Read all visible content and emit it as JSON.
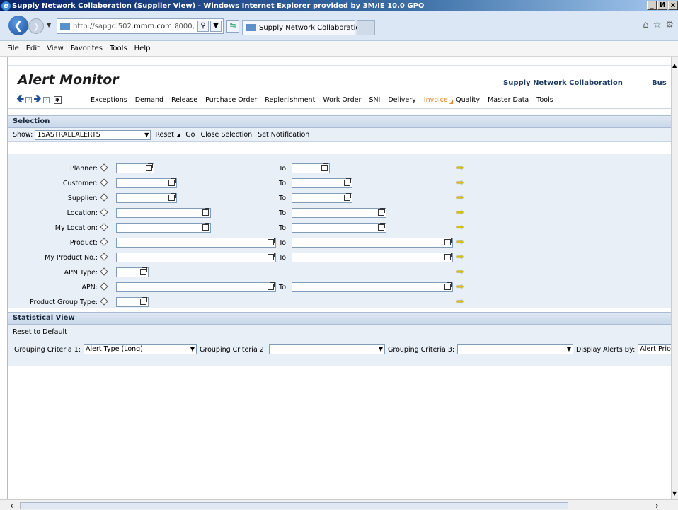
{
  "window": {
    "title": "Supply Network Collaboration (Supplier View) - Windows Internet Explorer provided by 3M/IE 10.0 GPO",
    "controls": [
      "_",
      "И",
      "x"
    ]
  },
  "browser": {
    "url_prefix": "http://sapgdl502.",
    "url_domain": "mmm.com",
    "url_suffix": ":8000,",
    "tab_label": "Supply Network Collaboratio...",
    "tab_close": "✖",
    "menu": [
      "File",
      "Edit",
      "View",
      "Favorites",
      "Tools",
      "Help"
    ]
  },
  "app": {
    "title": "Alert Monitor",
    "brand": "Supply Network Collaboration",
    "brand2": "Bus",
    "nav_items": [
      "Exceptions",
      "Demand",
      "Release",
      "Purchase Order",
      "Replenishment",
      "Work Order",
      "SNI",
      "Delivery",
      "Invoice",
      "Quality",
      "Master Data",
      "Tools"
    ],
    "active_nav": "Invoice"
  },
  "selection": {
    "header": "Selection",
    "show_label": "Show:",
    "show_value": "15ASTRALLALERTS",
    "reset": "Reset",
    "go": "Go",
    "close_selection": "Close Selection",
    "set_notification": "Set Notification",
    "to_label": "To",
    "fields": [
      {
        "label": "Planner:"
      },
      {
        "label": "Customer:"
      },
      {
        "label": "Supplier:"
      },
      {
        "label": "Location:"
      },
      {
        "label": "My Location:"
      },
      {
        "label": "Product:"
      },
      {
        "label": "My Product No.:"
      },
      {
        "label": "APN Type:"
      },
      {
        "label": "APN:"
      },
      {
        "label": "Product Group Type:"
      }
    ]
  },
  "statistical": {
    "header": "Statistical View",
    "reset_default": "Reset to Default",
    "grouping1_label": "Grouping Criteria 1:",
    "grouping1_value": "Alert Type (Long)",
    "grouping2_label": "Grouping Criteria 2:",
    "grouping2_value": "",
    "grouping3_label": "Grouping Criteria 3:",
    "grouping3_value": "",
    "display_label": "Display Alerts By:",
    "display_value": "Alert Prio"
  }
}
